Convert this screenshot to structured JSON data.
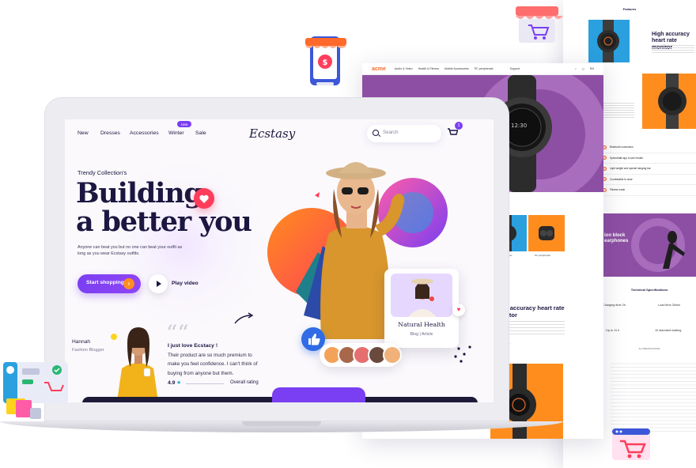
{
  "acme": {
    "logo": "acme",
    "nav": [
      "Audio & Video",
      "Health & Fitness",
      "Mobile Accessories",
      "PC peripherals",
      "Support"
    ],
    "lang": "EN",
    "category_heading": "gory",
    "cards": [
      "Mobile accessories",
      "PC peripherals"
    ],
    "feature_title": "High accuracy heart rate monitor",
    "feature_link": "PLAY VIDEO ›"
  },
  "features_page": {
    "title": "Features",
    "heading": "High accuracy heart rate monitor",
    "heading_partial": "ccuracy heart\nonitor",
    "spec_items": [
      "Bluetooth connection",
      "Speechtalk app to see results",
      "Light weight and special hanging bar",
      "Comfortable to wear",
      "Fitness mode"
    ],
    "purple_text": "ion block\nearphones",
    "tech_title": "Technical Specifications",
    "tech_cells": [
      "Charging time 2h",
      "Load time 30min",
      "Up to 11 h",
      "10 standard loading"
    ],
    "tech_small": "ALL SPECIFICATIONS"
  },
  "screen": {
    "nav": {
      "items": [
        "New",
        "Dresses",
        "Accessories",
        "Winter",
        "Sale"
      ],
      "badge": "new",
      "brand": "Ecstasy",
      "search_placeholder": "Search",
      "cart_count": "1"
    },
    "hero": {
      "eyebrow": "Trendy Collection's",
      "headline_line1": "Building",
      "headline_line2": "a better you",
      "subtext": "Anyone can beat you but no one can beat your outfit as long as you wear Ecstasy outfits.",
      "cta_primary": "Start shopping",
      "cta_secondary": "Play video"
    },
    "testimonial": {
      "name": "Hannah",
      "role": "Fashion Blogger",
      "quote_marks": "““",
      "title": "I just love Ecstacy !",
      "body": "Their product are so much premium to make you feel confidence. I can't think of buying from anyone but them.",
      "rating": "4.9",
      "rating_label": "Overall rating"
    },
    "card": {
      "title": "Natural Health",
      "subtitle": "Blog | Article"
    }
  },
  "colors": {
    "primary": "#7a3ff2",
    "accent_orange": "#ff8d1e",
    "accent_red": "#ff3d5a",
    "acme_purple": "#8d4fa3",
    "ink": "#1b1740"
  }
}
